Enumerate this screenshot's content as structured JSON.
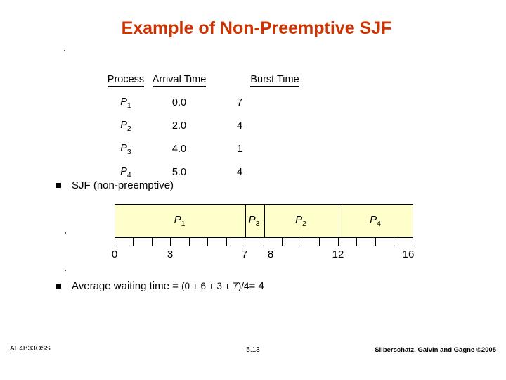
{
  "slide": {
    "title": "Example of Non-Preemptive SJF",
    "title_color": "#cc3300"
  },
  "process_table": {
    "headers": [
      "Process",
      "Arrival Time",
      "Burst Time"
    ],
    "rows": [
      {
        "process": "P",
        "index": "1",
        "arrival": "0.0",
        "burst": "7"
      },
      {
        "process": "P",
        "index": "2",
        "arrival": "2.0",
        "burst": "4"
      },
      {
        "process": "P",
        "index": "3",
        "arrival": "4.0",
        "burst": "1"
      },
      {
        "process": "P",
        "index": "4",
        "arrival": "5.0",
        "burst": "4"
      }
    ]
  },
  "bullets": {
    "sjf_label": "SJF (non-preemptive)",
    "avg_prefix": "Average waiting time = ",
    "avg_expr": "(0 + 6 + 3 + 7)/4",
    "avg_suffix": "= 4"
  },
  "gantt": {
    "fill_color": "#ffffcc",
    "blocks": [
      {
        "label": "P",
        "index": "1",
        "start": 0,
        "end": 7
      },
      {
        "label": "P",
        "index": "3",
        "start": 7,
        "end": 8
      },
      {
        "label": "P",
        "index": "2",
        "start": 8,
        "end": 12
      },
      {
        "label": "P",
        "index": "4",
        "start": 12,
        "end": 16
      }
    ],
    "axis_ticks": [
      "0",
      "3",
      "7",
      "8",
      "12",
      "16"
    ]
  },
  "footer": {
    "left": "AE4B33OSS",
    "center": "5.13",
    "right": "Silberschatz, Galvin and Gagne ©2005"
  }
}
